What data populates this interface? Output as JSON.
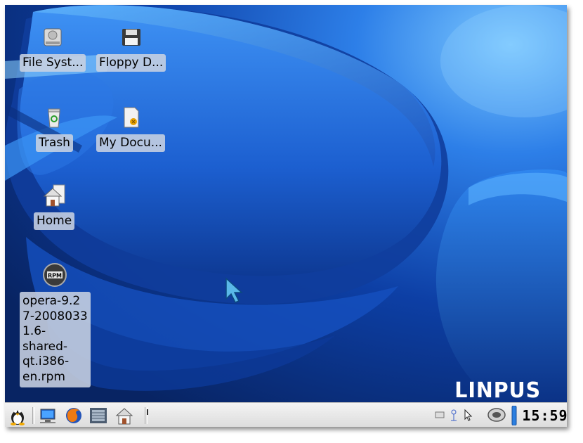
{
  "desktop": {
    "icons": [
      {
        "label": "File Syst...",
        "icon": "harddrive-icon"
      },
      {
        "label": "Floppy D...",
        "icon": "floppy-icon"
      },
      {
        "label": "Trash",
        "icon": "trash-icon"
      },
      {
        "label": "My Docu...",
        "icon": "documents-icon"
      },
      {
        "label": "Home",
        "icon": "home-icon"
      },
      {
        "label": "opera-9.2\n7-2008033\n1.6-\nshared-\nqt.i386-\nen.rpm",
        "icon": "rpm-package-icon"
      }
    ],
    "brand": "LINPUS"
  },
  "taskbar": {
    "launchers": [
      "linpus-menu-icon",
      "network-computer-icon",
      "firefox-icon",
      "file-manager-icon",
      "home-icon"
    ],
    "tray": [
      "keyboard-icon",
      "bluetooth-icon",
      "mouse-icon",
      "speaker-icon"
    ],
    "clock": "15:59"
  },
  "colors": {
    "wallpaper_dark": "#0a2a6e",
    "wallpaper_light": "#4aa0ff",
    "label_bg": "#c8d2e1",
    "taskbar_bg": "#e8e8e8"
  }
}
